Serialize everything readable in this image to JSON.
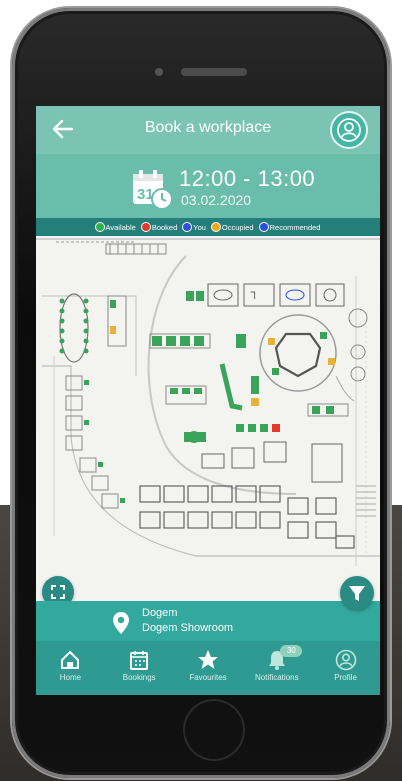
{
  "header": {
    "title": "Book a workplace"
  },
  "booking": {
    "time_range": "12:00 - 13:00",
    "date": "03.02.2020",
    "calendar_day": "31"
  },
  "legend": [
    {
      "label": "Available",
      "color": "#2db34a"
    },
    {
      "label": "Booked",
      "color": "#e23a2b"
    },
    {
      "label": "You",
      "color": "#2b4fe0"
    },
    {
      "label": "Occupied",
      "color": "#f0a91c"
    },
    {
      "label": "Recommended",
      "color": "#2b4fe0"
    }
  ],
  "location": {
    "name": "Dogem",
    "room": "Dogem Showroom"
  },
  "nav": [
    {
      "label": "Home",
      "icon": "home-icon"
    },
    {
      "label": "Bookings",
      "icon": "calendar-icon"
    },
    {
      "label": "Favourites",
      "icon": "star-icon"
    },
    {
      "label": "Notifications",
      "icon": "bell-icon",
      "badge": "30"
    },
    {
      "label": "Profile",
      "icon": "profile-icon"
    }
  ]
}
